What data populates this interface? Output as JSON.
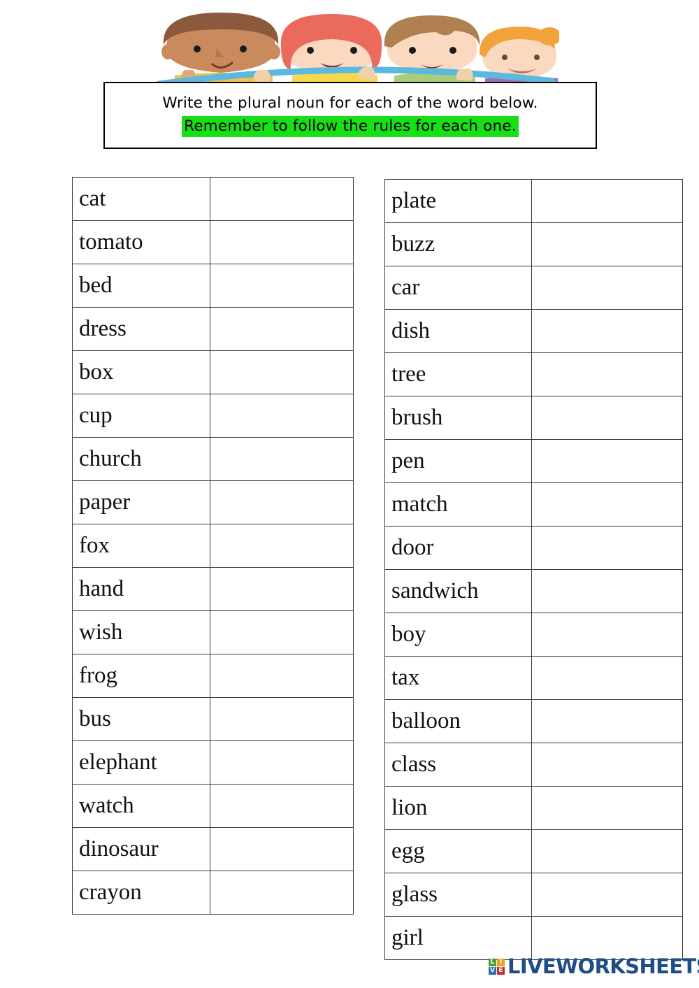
{
  "header": {
    "illustration_name": "four-children-holding-banner",
    "children": [
      {
        "hair": "#8B5A3C",
        "skin": "#C98B5E",
        "shirt": "#F2C14E"
      },
      {
        "hair": "#EB6A5E",
        "skin": "#FBD9C0",
        "shirt": "#F6D84F"
      },
      {
        "hair": "#B08050",
        "skin": "#FBD9C0",
        "shirt": "#A9CE7A"
      },
      {
        "hair": "#F2A33C",
        "skin": "#FBD9C0",
        "shirt": "#9C6FB0"
      }
    ],
    "banner_color": "#5BB8DE"
  },
  "instructions": {
    "line1": "Write the plural noun for each of the word below.",
    "line2": "Remember to follow the rules for each one.",
    "highlight_color": "#17E017"
  },
  "tables": {
    "left": {
      "rows": [
        {
          "word": "cat",
          "answer": ""
        },
        {
          "word": "tomato",
          "answer": ""
        },
        {
          "word": "bed",
          "answer": ""
        },
        {
          "word": "dress",
          "answer": ""
        },
        {
          "word": "box",
          "answer": ""
        },
        {
          "word": "cup",
          "answer": ""
        },
        {
          "word": "church",
          "answer": ""
        },
        {
          "word": "paper",
          "answer": ""
        },
        {
          "word": "fox",
          "answer": ""
        },
        {
          "word": "hand",
          "answer": ""
        },
        {
          "word": "wish",
          "answer": ""
        },
        {
          "word": "frog",
          "answer": ""
        },
        {
          "word": "bus",
          "answer": ""
        },
        {
          "word": "elephant",
          "answer": ""
        },
        {
          "word": "watch",
          "answer": ""
        },
        {
          "word": "dinosaur",
          "answer": ""
        },
        {
          "word": "crayon",
          "answer": ""
        }
      ]
    },
    "right": {
      "rows": [
        {
          "word": "plate",
          "answer": ""
        },
        {
          "word": "buzz",
          "answer": ""
        },
        {
          "word": "car",
          "answer": ""
        },
        {
          "word": "dish",
          "answer": ""
        },
        {
          "word": "tree",
          "answer": ""
        },
        {
          "word": "brush",
          "answer": ""
        },
        {
          "word": "pen",
          "answer": ""
        },
        {
          "word": "match",
          "answer": ""
        },
        {
          "word": "door",
          "answer": ""
        },
        {
          "word": "sandwich",
          "answer": ""
        },
        {
          "word": "boy",
          "answer": ""
        },
        {
          "word": "tax",
          "answer": ""
        },
        {
          "word": "balloon",
          "answer": ""
        },
        {
          "word": "class",
          "answer": ""
        },
        {
          "word": "lion",
          "answer": ""
        },
        {
          "word": "egg",
          "answer": ""
        },
        {
          "word": "glass",
          "answer": ""
        },
        {
          "word": "girl",
          "answer": ""
        }
      ]
    }
  },
  "footer": {
    "wordmark": "LIVEWORKSHEETS",
    "wordmark_color": "#1F4E87",
    "tiles": [
      {
        "letter": "L",
        "color": "#4C9E3F"
      },
      {
        "letter": "I",
        "color": "#E8A317"
      },
      {
        "letter": "V",
        "color": "#2E6DB4"
      },
      {
        "letter": "E",
        "color": "#CC2A2A"
      }
    ]
  }
}
